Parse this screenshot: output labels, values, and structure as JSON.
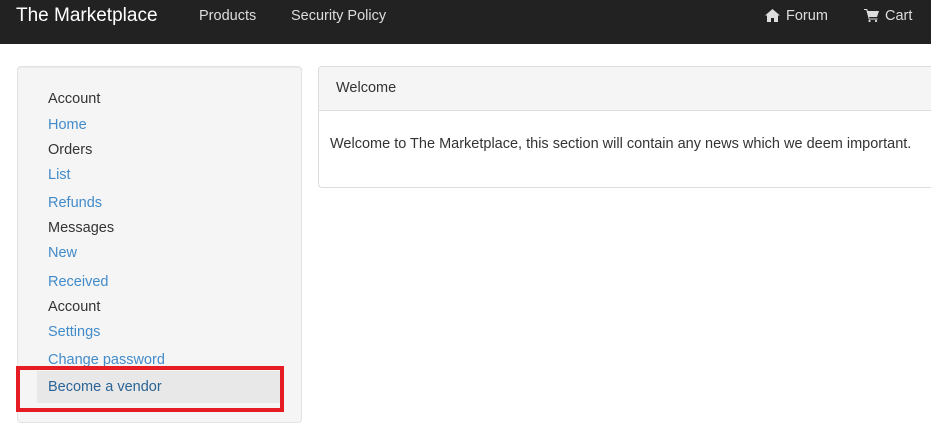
{
  "navbar": {
    "brand": "The Marketplace",
    "links": [
      {
        "label": "Products"
      },
      {
        "label": "Security Policy"
      },
      {
        "label": "Forum",
        "icon": "home-icon"
      },
      {
        "label": "Cart",
        "icon": "cart-icon"
      }
    ]
  },
  "sidebar": {
    "items": [
      {
        "label": "Account",
        "type": "header"
      },
      {
        "label": "Home",
        "type": "link"
      },
      {
        "label": "Orders",
        "type": "header"
      },
      {
        "label": "List",
        "type": "link"
      },
      {
        "label": "Refunds",
        "type": "link"
      },
      {
        "label": "Messages",
        "type": "header"
      },
      {
        "label": "New",
        "type": "link"
      },
      {
        "label": "Received",
        "type": "link"
      },
      {
        "label": "Account",
        "type": "header"
      },
      {
        "label": "Settings",
        "type": "link"
      },
      {
        "label": "Change password",
        "type": "link"
      },
      {
        "label": "Become a vendor",
        "type": "link",
        "active": true
      }
    ]
  },
  "panel": {
    "heading": "Welcome",
    "body": "Welcome to The Marketplace, this section will contain any news which we deem important."
  },
  "colors": {
    "navbar_bg": "#222222",
    "link": "#428bca",
    "highlight": "#e51c23"
  }
}
